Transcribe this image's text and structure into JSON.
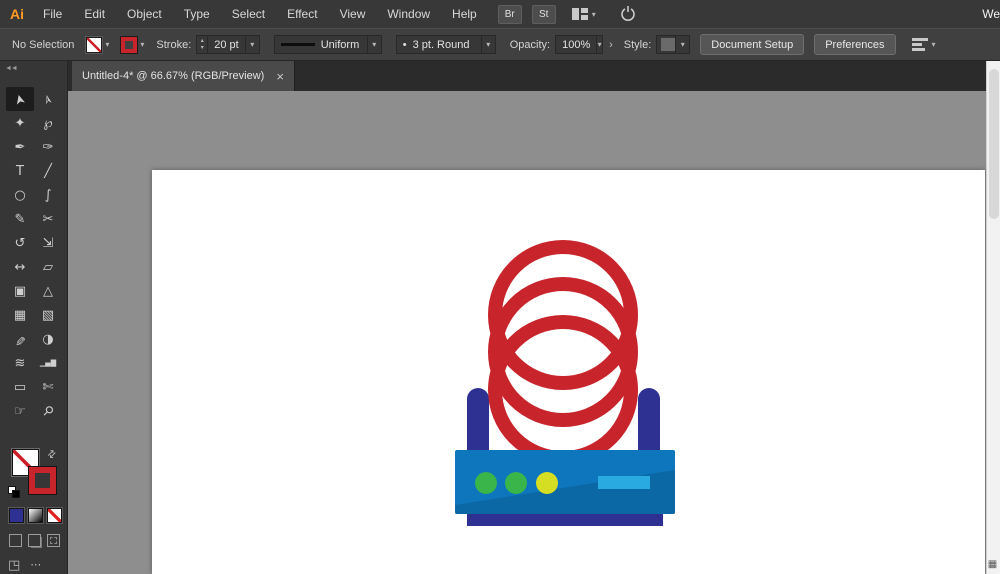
{
  "menubar": {
    "logo": "Ai",
    "items": [
      "File",
      "Edit",
      "Object",
      "Type",
      "Select",
      "Effect",
      "View",
      "Window",
      "Help"
    ],
    "bridge_button": "Br",
    "stock_button": "St",
    "right_partial_text": "We"
  },
  "controlbar": {
    "selection_status": "No Selection",
    "stroke_label": "Stroke:",
    "stroke_weight": "20 pt",
    "width_profile": "Uniform",
    "brush_bullet": "•",
    "brush": "3 pt. Round",
    "opacity_label": "Opacity:",
    "opacity_value": "100%",
    "style_label": "Style:",
    "document_setup": "Document Setup",
    "preferences": "Preferences"
  },
  "tabbar": {
    "tab_title": "Untitled-4* @ 66.67% (RGB/Preview)"
  },
  "icons": {
    "chevron": "▾",
    "up_arrow": "▴",
    "down_arrow": "▾",
    "swap": "⇄",
    "submenu_arrow": "›",
    "collapse": "◄◄",
    "close": "×",
    "corner_grid": "▦",
    "screen_mode": "◳",
    "more": "⋯"
  },
  "toolbar": {
    "tools": [
      {
        "name": "selection",
        "glyph": "➤",
        "rotate": -105,
        "active": true
      },
      {
        "name": "direct-selection",
        "glyph": "➢",
        "rotate": -105
      },
      {
        "name": "magic-wand",
        "glyph": "✦"
      },
      {
        "name": "lasso",
        "glyph": "℘"
      },
      {
        "name": "pen",
        "glyph": "✒"
      },
      {
        "name": "curvature",
        "glyph": "✑"
      },
      {
        "name": "type",
        "glyph": "T"
      },
      {
        "name": "line-segment",
        "glyph": "╱"
      },
      {
        "name": "ellipse",
        "glyph": "○"
      },
      {
        "name": "paintbrush",
        "glyph": "∫"
      },
      {
        "name": "pencil",
        "glyph": "✎"
      },
      {
        "name": "scissors",
        "glyph": "✂"
      },
      {
        "name": "rotate",
        "glyph": "↺"
      },
      {
        "name": "scale",
        "glyph": "⇲"
      },
      {
        "name": "width",
        "glyph": "↔"
      },
      {
        "name": "free-transform",
        "glyph": "▱"
      },
      {
        "name": "shape-builder",
        "glyph": "▣"
      },
      {
        "name": "perspective-grid",
        "glyph": "△"
      },
      {
        "name": "mesh",
        "glyph": "▦"
      },
      {
        "name": "gradient",
        "glyph": "▧"
      },
      {
        "name": "eyedropper",
        "glyph": "✐",
        "rotate": 180
      },
      {
        "name": "blend",
        "glyph": "◑"
      },
      {
        "name": "symbol-sprayer",
        "glyph": "≋"
      },
      {
        "name": "column-graph",
        "glyph": "▁▄▇",
        "size": 7
      },
      {
        "name": "artboard",
        "glyph": "▭"
      },
      {
        "name": "slice",
        "glyph": "✄"
      },
      {
        "name": "hand",
        "glyph": "☞"
      },
      {
        "name": "zoom",
        "glyph": "⚲",
        "rotate": 45
      }
    ]
  },
  "swatches": {
    "color_button": "#2e3192"
  },
  "artwork": {
    "description": "red cable coil on blue reel device",
    "colors": {
      "red": "#c8242b",
      "navy": "#2e3192",
      "blue": "#0e76bc",
      "lightblue": "#29abe2",
      "green": "#39b54a",
      "yellow": "#d6de23",
      "shade": "rgba(0,0,0,0.12)"
    }
  }
}
